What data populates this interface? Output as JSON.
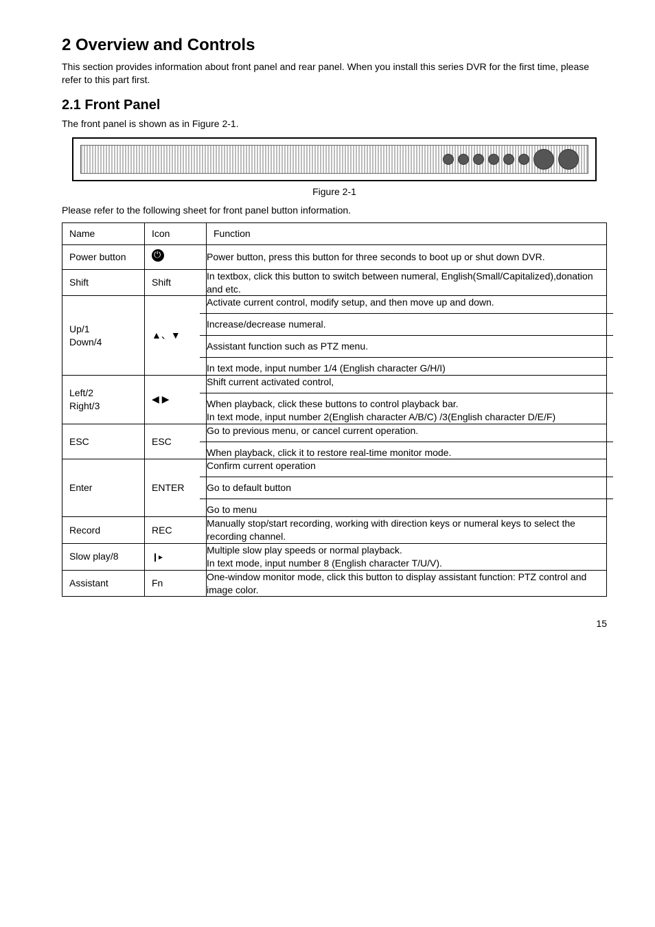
{
  "headings": {
    "h1": "2  Overview and Controls",
    "h2": "2.1  Front Panel"
  },
  "paragraphs": {
    "intro": "This section provides information about front panel and rear panel. When you install this series DVR for the first time, please refer to this part first.",
    "front": "The front panel is shown as in Figure 2-1.",
    "caption": "Figure 2-1",
    "tableLead": "Please refer to the following sheet for front panel button information."
  },
  "table": {
    "headers": {
      "name": "Name",
      "icon": "Icon",
      "func": "Function"
    },
    "rows": [
      {
        "name": "Power button",
        "iconType": "power",
        "funcs": [
          "Power button, press this button for three seconds to boot up or shut down DVR."
        ]
      },
      {
        "name": "Shift",
        "iconText": "Shift",
        "funcs": [
          "In textbox, click this button to switch between numeral, English(Small/Capitalized),donation and etc."
        ]
      },
      {
        "name": "Up/1\nDown/4",
        "iconType": "updown",
        "funcs": [
          "Activate current control, modify setup, and then move up and down.",
          "Increase/decrease numeral.",
          "Assistant function such as PTZ menu.",
          "In text mode, input number 1/4 (English character G/H/I)"
        ]
      },
      {
        "name": "Left/2\nRight/3",
        "iconType": "leftright",
        "funcs": [
          "Shift current activated control,",
          "When playback, click these buttons to control playback bar.\nIn text mode, input number 2(English character A/B/C) /3(English character D/E/F)"
        ]
      },
      {
        "name": "ESC",
        "iconText": "ESC",
        "funcs": [
          "Go to previous menu, or cancel current operation.",
          "When playback, click it to restore real-time monitor mode."
        ]
      },
      {
        "name": "Enter",
        "iconText": "ENTER",
        "funcs": [
          "Confirm current operation",
          "Go to default button",
          "Go to menu"
        ]
      },
      {
        "name": "Record",
        "iconText": "REC",
        "funcs": [
          "Manually stop/start recording, working with direction keys or numeral keys to select the recording channel."
        ]
      },
      {
        "name": "Slow play/8",
        "iconType": "slow",
        "funcs": [
          "Multiple slow play speeds or normal playback.\nIn text mode, input number 8 (English character T/U/V)."
        ]
      },
      {
        "name": "Assistant",
        "iconText": "Fn",
        "funcs": [
          "One-window monitor mode, click this button to display assistant function: PTZ control and image color."
        ]
      }
    ]
  },
  "pageNumber": "15"
}
